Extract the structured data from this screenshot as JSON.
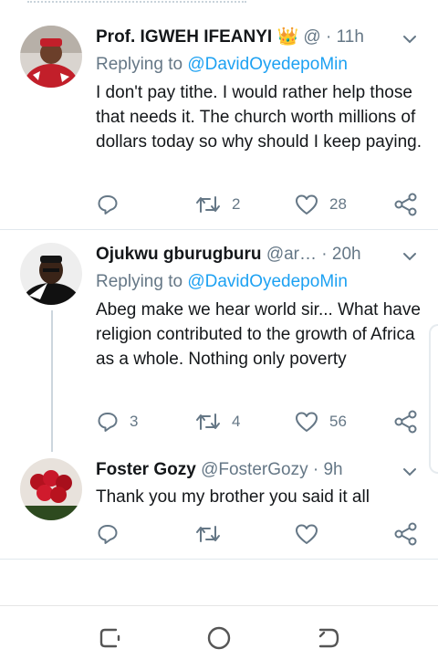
{
  "tweets": [
    {
      "name": "Prof. IGWEH IFEANYI",
      "name_emoji": "👑",
      "handle": "@",
      "sep": "·",
      "time": "11h",
      "reply_prefix": "Replying to",
      "reply_handle": "@DavidOyedepoMin",
      "text": "I don't pay tithe. I would rather help those that needs it. The church worth millions of dollars today so why should I keep paying.",
      "retweets": "2",
      "likes": "28",
      "replies": ""
    },
    {
      "name": "Ojukwu gburugburu",
      "handle": "@ar…",
      "sep": "·",
      "time": "20h",
      "reply_prefix": "Replying to",
      "reply_handle": "@DavidOyedepoMin",
      "text": "Abeg make we hear world sir... What have religion contributed to the growth of Africa as a whole. Nothing only poverty",
      "replies": "3",
      "retweets": "4",
      "likes": "56"
    },
    {
      "name": "Foster Gozy",
      "handle": "@FosterGozy",
      "sep": "·",
      "time": "9h",
      "text": "Thank you my brother you said it all",
      "replies": "",
      "retweets": "",
      "likes": ""
    }
  ],
  "icons": {
    "reply": "reply-icon",
    "retweet": "retweet-icon",
    "like": "heart-icon",
    "share": "share-icon",
    "more": "chevron-down-icon"
  },
  "colors": {
    "link": "#1da1f2",
    "meta": "#657786",
    "text": "#14171a"
  }
}
